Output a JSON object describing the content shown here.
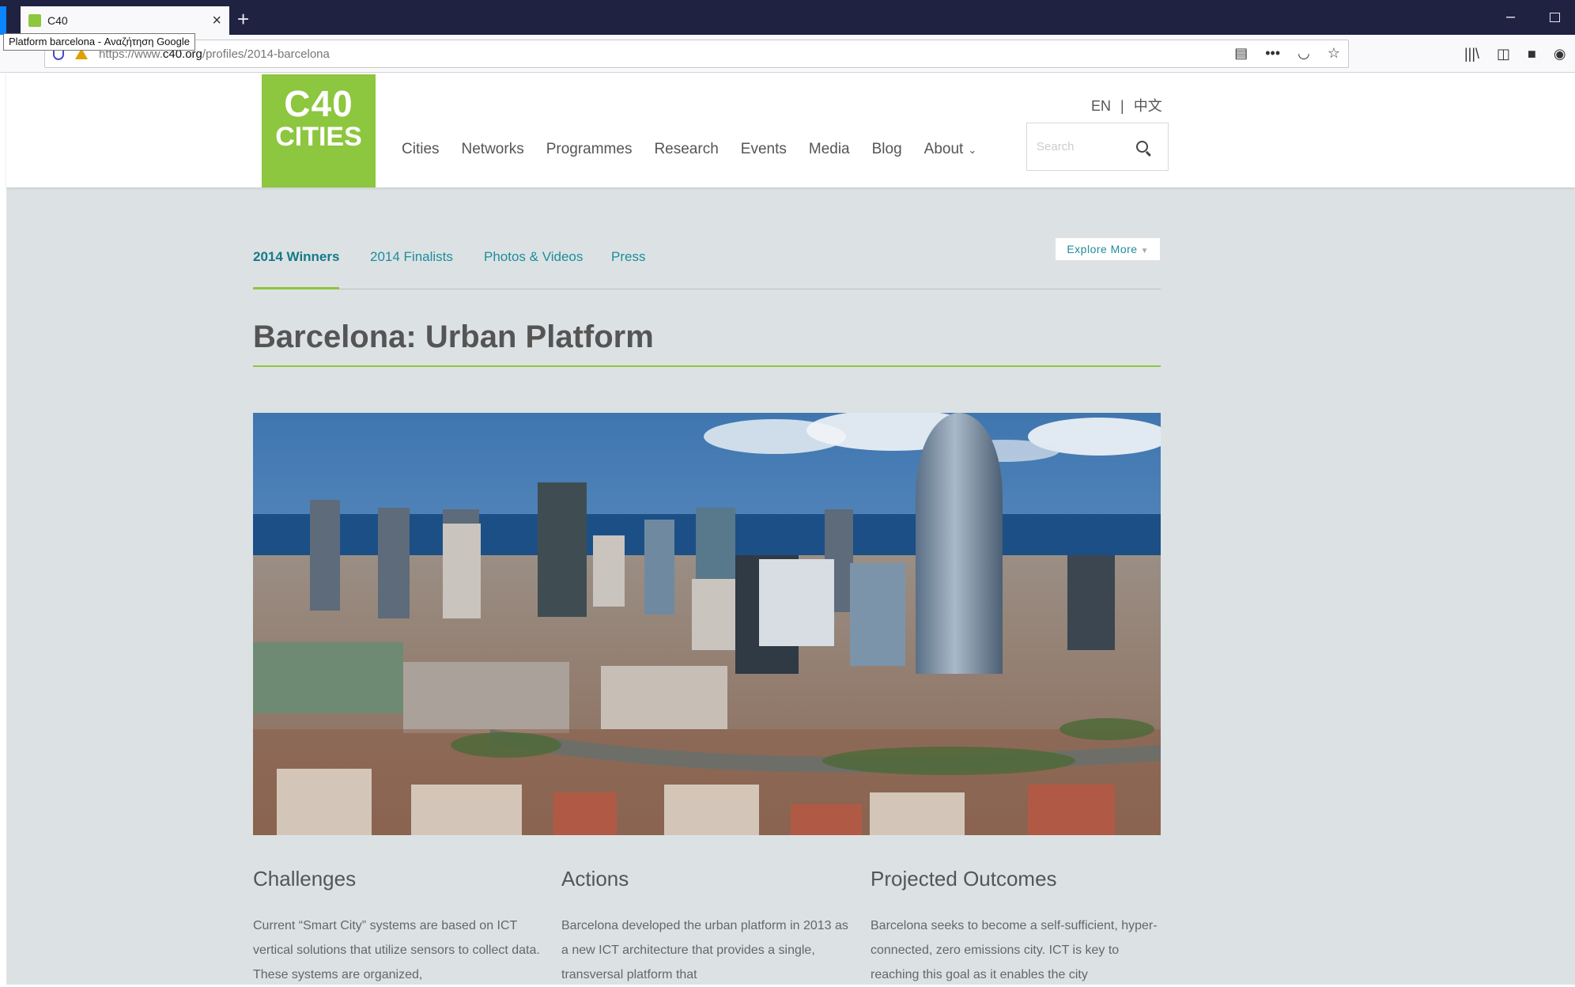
{
  "browser": {
    "tab_title": "C40",
    "tooltip": "Platform barcelona - Αναζήτηση Google",
    "url_prefix": "https://www.",
    "url_domain": "c40.org",
    "url_path": "/profiles/2014-barcelona"
  },
  "site": {
    "logo_line1": "C40",
    "logo_line2": "CITIES",
    "lang_en": "EN",
    "lang_sep": "|",
    "lang_zh": "中文",
    "nav": [
      "Cities",
      "Networks",
      "Programmes",
      "Research",
      "Events",
      "Media",
      "Blog",
      "About"
    ],
    "search_placeholder": "Search",
    "brand_color": "#8dc63f"
  },
  "subnav": {
    "tabs": [
      "2014 Winners",
      "2014 Finalists",
      "Photos & Videos",
      "Press"
    ],
    "active_tab": "2014 Winners",
    "explore_label": "Explore More"
  },
  "page": {
    "title": "Barcelona: Urban Platform"
  },
  "columns": [
    {
      "heading": "Challenges",
      "text": "Current “Smart City” systems are based on ICT vertical solutions that utilize sensors to collect data. These systems are organized,"
    },
    {
      "heading": "Actions",
      "text": "Barcelona developed the urban platform in 2013 as a new ICT architecture that provides a single, transversal platform that"
    },
    {
      "heading": "Projected Outcomes",
      "text": "Barcelona seeks to become a self-sufficient, hyper-connected, zero emissions city. ICT is key to reaching this goal as it enables the city"
    }
  ]
}
